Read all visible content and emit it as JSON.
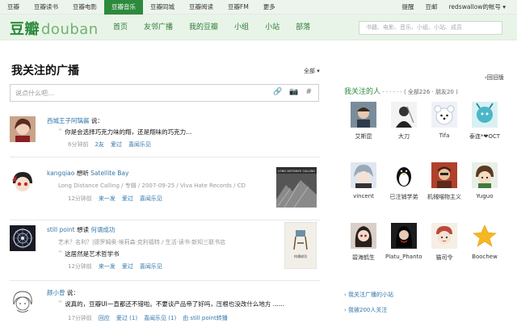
{
  "topnav": {
    "items": [
      "豆瓣",
      "豆瓣读书",
      "豆瓣电影",
      "豆瓣音乐",
      "豆瓣同城",
      "豆瓣阅读",
      "豆瓣FM",
      "更多"
    ],
    "active_index": 3,
    "right": [
      "提醒",
      "豆邮",
      "redswallow的帐号 ▾"
    ]
  },
  "header": {
    "logo_cn": "豆瓣",
    "logo_en": "douban",
    "nav": [
      "首页",
      "友邻广播",
      "我的豆瓣",
      "小组",
      "小站",
      "部落"
    ],
    "search_placeholder": "书籍、电影、音乐、小组、小站、成员"
  },
  "main": {
    "title": "我关注的广播",
    "filter": "全部 ▾",
    "post_placeholder": "说点什么吧...",
    "post_tools": [
      "🔗",
      "📷",
      "#"
    ]
  },
  "statuses": [
    {
      "user": "西城王子阿璃酱",
      "verb": "说：",
      "object": "",
      "quote": "你是会选择巧克力味的翔，还是翔味的巧克力...",
      "meta": "",
      "actions": [
        "6分钟前",
        "2友",
        "爱过",
        "喜闻乐见"
      ]
    },
    {
      "user": "kangqiao",
      "verb": "想听",
      "object": "Satellite Bay",
      "meta": "Long Distance Calling / 专辑 / 2007-09-25 / Viva Hate Records / CD",
      "quote": "",
      "actions": [
        "12分钟前",
        "来一发",
        "爱过",
        "喜闻乐见"
      ],
      "thumb_label": "LONG DISTANCE CALLING"
    },
    {
      "user": "still point",
      "verb": "想读",
      "object": "何谓成功",
      "meta": "艺术？名利？|德罗姆奥·埃莉森·克利福特 / 生活·读书·新知三联书店",
      "quote": "这居然是艺术哲学书",
      "actions": [
        "12分钟前",
        "来一发",
        "爱过",
        "喜闻乐见"
      ],
      "thumb_label": "何谓成功"
    },
    {
      "user": "颜小曾",
      "verb": "说：",
      "object": "",
      "quote": "说真的，豆瓣UI一直都还不错啦。不要谈产品帝了好吗，压根也没改什么地方 ......",
      "meta": "",
      "actions": [
        "17分钟前",
        "回应",
        "爱过 (1)",
        "喜闻乐见 (1)",
        "由 still point转播"
      ]
    }
  ],
  "sidebar": {
    "back": "›回旧版",
    "title": "我关注的人",
    "dots": " · · · · · · ",
    "count": "( 全部226 · 朋友20 )",
    "following": [
      "艾斯昆",
      "大刀",
      "Tifa",
      "泰连*❤OCT",
      "vincent",
      "已注销学弟",
      "机械喵物主义",
      "Yuguo",
      "碧海鹤生",
      "Platu_Phantom",
      "猫司令",
      "Boochew"
    ],
    "links": [
      "› 我关注广播的小站",
      "› 我被200人关注"
    ]
  },
  "colors": {
    "brand": "#2d8a3c",
    "link": "#3377aa"
  }
}
